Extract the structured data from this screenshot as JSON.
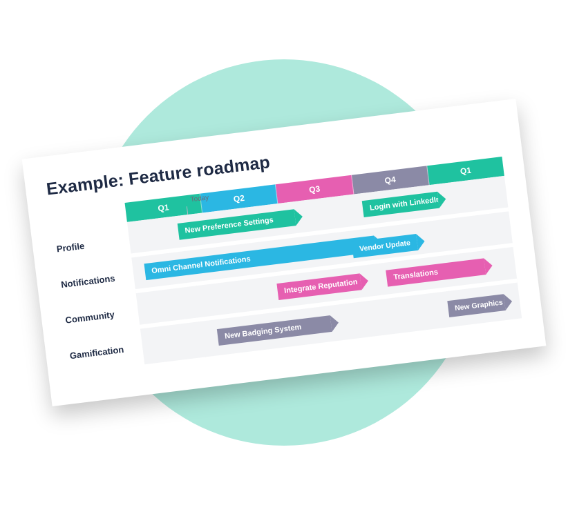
{
  "title": "Example: Feature roadmap",
  "today_label": "Today",
  "today_position_pct": 16,
  "columns": [
    {
      "label": "Q1",
      "color": "#1fc2a0"
    },
    {
      "label": "Q2",
      "color": "#2bb7e3"
    },
    {
      "label": "Q3",
      "color": "#e65fb1"
    },
    {
      "label": "Q4",
      "color": "#8b8aa6"
    },
    {
      "label": "Q1",
      "color": "#1fc2a0"
    }
  ],
  "rows": [
    {
      "name": "Profile"
    },
    {
      "name": "Notifications"
    },
    {
      "name": "Community"
    },
    {
      "name": "Gamification"
    }
  ],
  "chart_data": {
    "type": "gantt",
    "title": "Example: Feature roadmap",
    "x_categories": [
      "Q1",
      "Q2",
      "Q3",
      "Q4",
      "Q1"
    ],
    "swimlanes": [
      "Profile",
      "Notifications",
      "Community",
      "Gamification"
    ],
    "today_marker_pct": 16,
    "bars": [
      {
        "lane": "Profile",
        "label": "New Preference Settings",
        "start_pct": 13,
        "width_pct": 31,
        "color": "teal"
      },
      {
        "lane": "Profile",
        "label": "Login with LinkedIn",
        "start_pct": 62,
        "width_pct": 20,
        "color": "teal"
      },
      {
        "lane": "Notifications",
        "label": "Omni Channel Notifications",
        "start_pct": 3,
        "width_pct": 61,
        "color": "blue"
      },
      {
        "lane": "Notifications",
        "label": "Vendor Update",
        "start_pct": 58,
        "width_pct": 17,
        "color": "blue"
      },
      {
        "lane": "Community",
        "label": "Integrate Reputation",
        "start_pct": 37,
        "width_pct": 22,
        "color": "pink"
      },
      {
        "lane": "Community",
        "label": "Translations",
        "start_pct": 66,
        "width_pct": 26,
        "color": "pink"
      },
      {
        "lane": "Gamification",
        "label": "New Badging System",
        "start_pct": 20,
        "width_pct": 30,
        "color": "purple"
      },
      {
        "lane": "Gamification",
        "label": "New Graphics",
        "start_pct": 81,
        "width_pct": 15,
        "color": "purple"
      }
    ]
  }
}
